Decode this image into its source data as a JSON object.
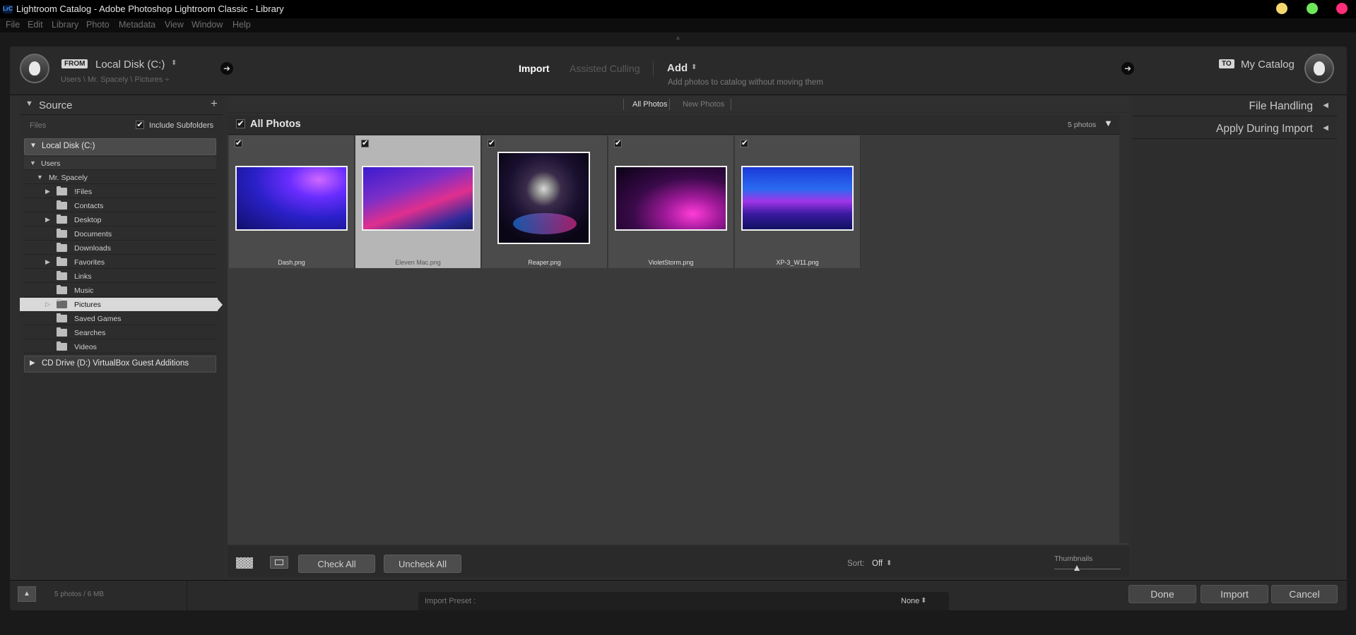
{
  "window": {
    "title": "Lightroom Catalog - Adobe Photoshop Lightroom Classic - Library",
    "app_icon": "LrC",
    "controls": [
      {
        "name": "minimize",
        "color": "#f5d76e"
      },
      {
        "name": "maximize",
        "color": "#6ee85a"
      },
      {
        "name": "close",
        "color": "#ff2d7a"
      }
    ]
  },
  "menu": [
    "File",
    "Edit",
    "Library",
    "Photo",
    "Metadata",
    "View",
    "Window",
    "Help"
  ],
  "header": {
    "from_tag": "FROM",
    "source_name": "Local Disk (C:)",
    "source_path": "Users \\ Mr. Spacely \\ Pictures ÷",
    "modes": {
      "import": "Import",
      "assisted_culling": "Assisted Culling"
    },
    "action": "Add",
    "action_desc": "Add photos to catalog without moving them",
    "to_tag": "TO",
    "destination": "My Catalog"
  },
  "source_panel": {
    "title": "Source",
    "files_label": "Files",
    "include_subfolders": "Include Subfolders",
    "include_subfolders_checked": true,
    "drive_c": "Local Disk (C:)",
    "users": "Users",
    "user": "Mr. Spacely",
    "folders": [
      {
        "label": "!Files",
        "expandable": true
      },
      {
        "label": "Contacts",
        "expandable": false
      },
      {
        "label": "Desktop",
        "expandable": true
      },
      {
        "label": "Documents",
        "expandable": false
      },
      {
        "label": "Downloads",
        "expandable": false
      },
      {
        "label": "Favorites",
        "expandable": true
      },
      {
        "label": "Links",
        "expandable": false
      },
      {
        "label": "Music",
        "expandable": false
      },
      {
        "label": "Pictures",
        "expandable": true,
        "selected": true
      },
      {
        "label": "Saved Games",
        "expandable": false
      },
      {
        "label": "Searches",
        "expandable": false
      },
      {
        "label": "Videos",
        "expandable": false
      }
    ],
    "drive_d": "CD Drive (D:) VirtualBox Guest Additions"
  },
  "grid": {
    "filter_tabs": {
      "all": "All Photos",
      "new": "New Photos"
    },
    "section_title": "All Photos",
    "count": "5 photos",
    "photos": [
      {
        "name": "Dash.png",
        "checked": true,
        "selected": false
      },
      {
        "name": "Eleven Mac.png",
        "checked": true,
        "selected": true
      },
      {
        "name": "Reaper.png",
        "checked": true,
        "selected": false
      },
      {
        "name": "VioletStorm.png",
        "checked": true,
        "selected": false
      },
      {
        "name": "XP-3_W11.png",
        "checked": true,
        "selected": false
      }
    ]
  },
  "toolbar": {
    "check_all": "Check All",
    "uncheck_all": "Uncheck All",
    "sort_label": "Sort:",
    "sort_value": "Off",
    "thumbnails_label": "Thumbnails",
    "thumbnail_size": 0.35
  },
  "right_panel": {
    "file_handling": "File Handling",
    "apply_during_import": "Apply During Import"
  },
  "bottom": {
    "summary": "5 photos / 6 MB",
    "preset_label": "Import Preset :",
    "preset_value": "None",
    "done": "Done",
    "import": "Import",
    "cancel": "Cancel"
  }
}
